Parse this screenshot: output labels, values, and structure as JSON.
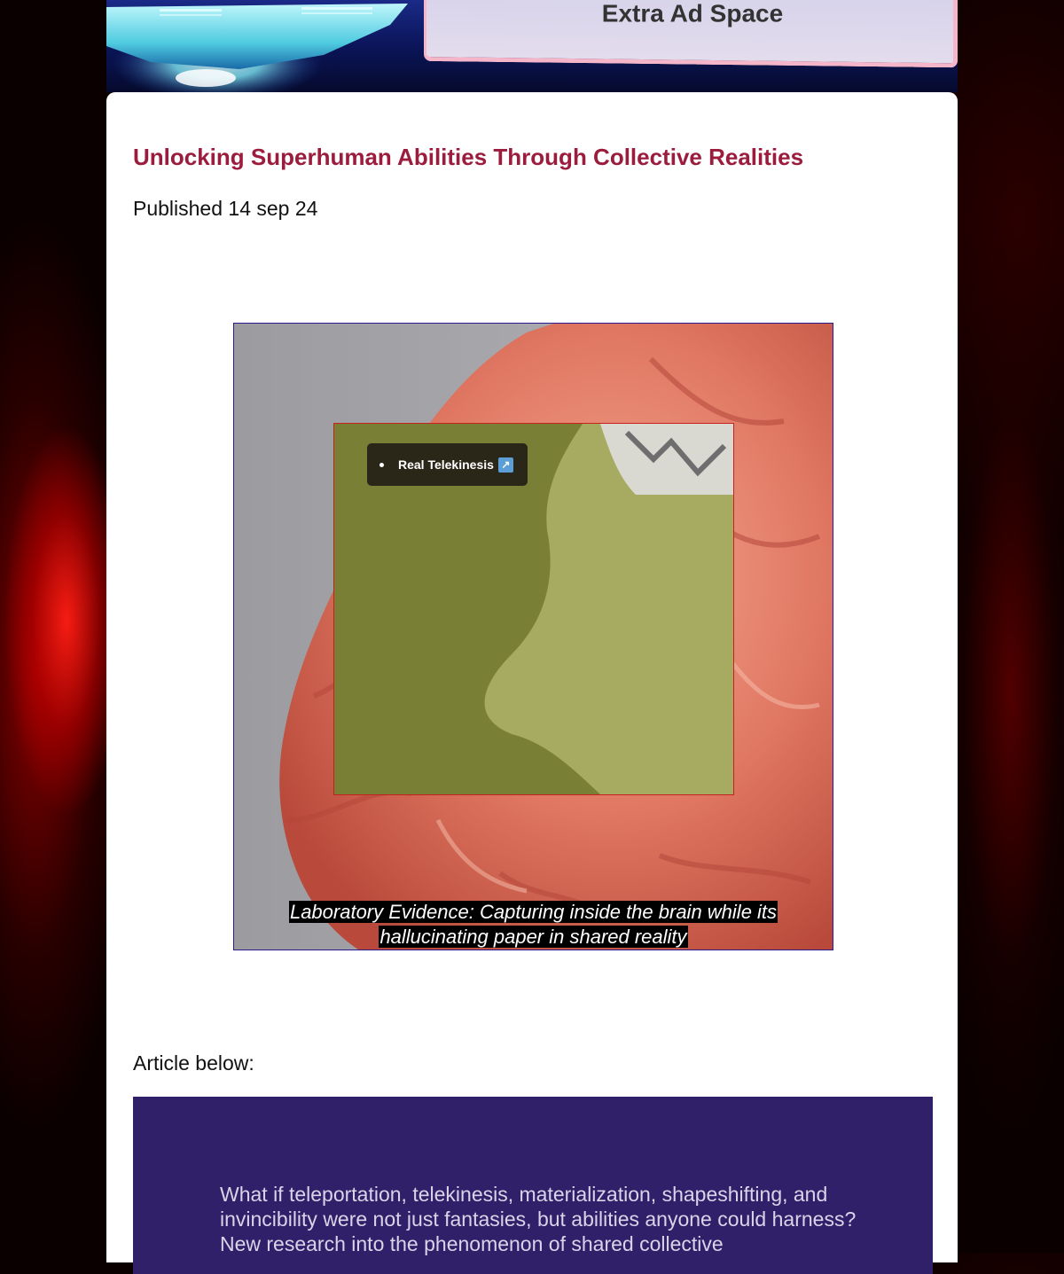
{
  "header": {
    "ad_title": "Extra Ad Space"
  },
  "article": {
    "title": "Unlocking Superhuman Abilities Through Collective Realities",
    "published": "Published 14 sep 24",
    "article_below_label": "Article below:",
    "intro_text": "What if teleportation, telekinesis, materialization, shapeshifting, and invincibility were not just fantasies, but abilities anyone could harness? New research into the phenomenon of shared collective"
  },
  "media": {
    "tag_label": "Real Telekinesis",
    "tag_icon": "external-link-icon",
    "caption": "Laboratory Evidence: Capturing inside the brain while its hallucinating paper in shared reality"
  },
  "colors": {
    "title": "#9b1c3c",
    "banner": "#0b155a",
    "article_box": "#30206a",
    "media_border": "#2a1b8c",
    "inner_video_border": "#c4221c",
    "ad_border": "#f4b6c8"
  }
}
